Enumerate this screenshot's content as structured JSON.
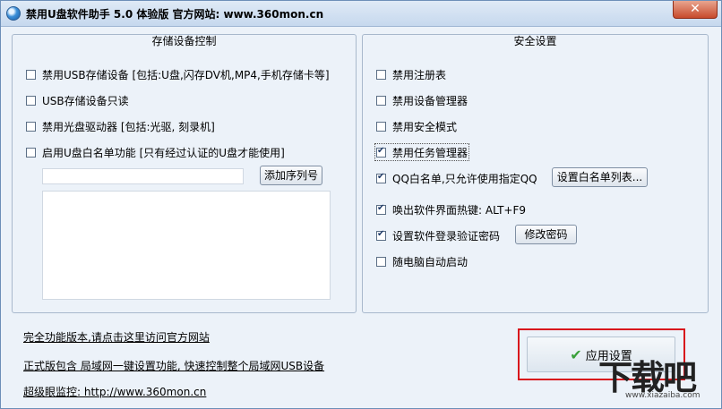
{
  "window": {
    "title": "禁用U盘软件助手 5.0 体验版 官方网站: www.360mon.cn",
    "close_glyph": "✕"
  },
  "storage_group": {
    "title": "存储设备控制",
    "items": [
      {
        "label": "禁用USB存储设备 [包括:U盘,闪存DV机,MP4,手机存储卡等]",
        "checked": false
      },
      {
        "label": "USB存储设备只读",
        "checked": false
      },
      {
        "label": "禁用光盘驱动器 [包括:光驱, 刻录机]",
        "checked": false
      },
      {
        "label": "启用U盘白名单功能 [只有经过认证的U盘才能使用]",
        "checked": false
      }
    ],
    "serial_input_value": "",
    "add_serial_label": "添加序列号"
  },
  "security_group": {
    "title": "安全设置",
    "items": [
      {
        "label": "禁用注册表",
        "checked": false
      },
      {
        "label": "禁用设备管理器",
        "checked": false
      },
      {
        "label": "禁用安全模式",
        "checked": false
      },
      {
        "label": "禁用任务管理器",
        "checked": true
      },
      {
        "label": "QQ白名单,只允许使用指定QQ",
        "checked": true
      },
      {
        "label": "唤出软件界面热键: ALT+F9",
        "checked": true
      },
      {
        "label": "设置软件登录验证密码",
        "checked": true
      },
      {
        "label": "随电脑自动启动",
        "checked": false
      }
    ],
    "qq_whitelist_button": "设置白名单列表...",
    "change_password_button": "修改密码"
  },
  "footer": {
    "link_full_version": "完全功能版本,请点击这里访问官方网站",
    "link_lan": "正式版包含 局域网一键设置功能, 快速控制整个局域网USB设备",
    "link_monitor": "超级眼监控: http://www.360mon.cn",
    "apply_button": "应用设置"
  },
  "watermark": {
    "text": "下载吧",
    "sub": "www.xiazaiba.com"
  },
  "colors": {
    "highlight": "#d8141c",
    "window_bg": "#ecf2f9"
  }
}
